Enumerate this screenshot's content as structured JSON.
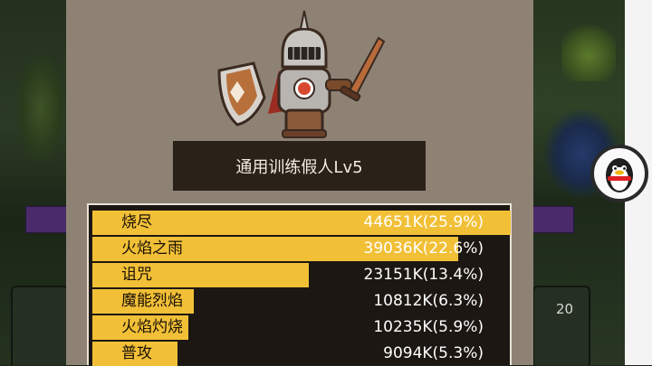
{
  "dummy": {
    "title": "通用训练假人Lv5"
  },
  "damage_list": [
    {
      "name": "烧尽",
      "value": "44651K(25.9%)",
      "fill": 1.0
    },
    {
      "name": "火焰之雨",
      "value": "39036K(22.6%)",
      "fill": 0.874
    },
    {
      "name": "诅咒",
      "value": "23151K(13.4%)",
      "fill": 0.518
    },
    {
      "name": "魔能烈焰",
      "value": "10812K(6.3%)",
      "fill": 0.242
    },
    {
      "name": "火焰灼烧",
      "value": "10235K(5.9%)",
      "fill": 0.229
    },
    {
      "name": "普攻",
      "value": "9094K(5.3%)",
      "fill": 0.204
    }
  ],
  "background": {
    "card_level": "20"
  },
  "colors": {
    "bar": "#f2c037",
    "panel": "#8e8275",
    "title_bg": "#2a2119",
    "list_bg": "#1c1712"
  }
}
